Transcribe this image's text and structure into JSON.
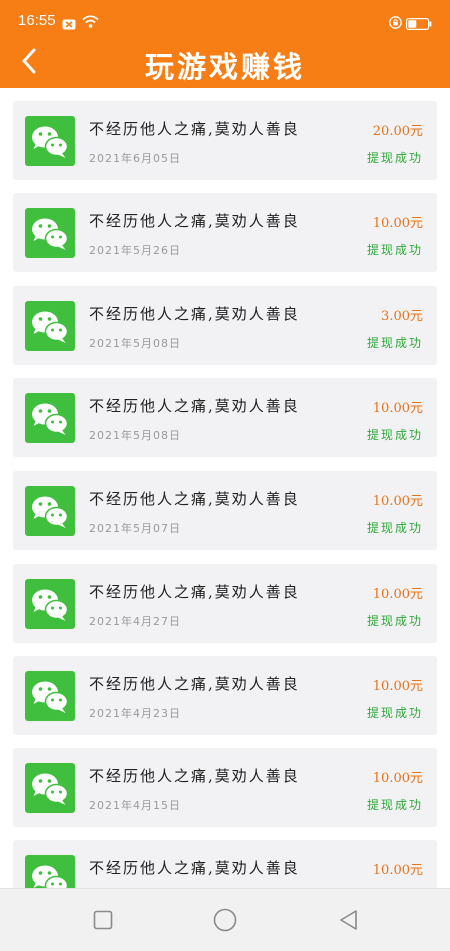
{
  "status_bar": {
    "time": "16:55"
  },
  "header": {
    "title": "玩游戏赚钱"
  },
  "items": [
    {
      "title": "不经历他人之痛,莫劝人善良",
      "date": "2021年6月05日",
      "amount": "20.00元",
      "status": "提现成功"
    },
    {
      "title": "不经历他人之痛,莫劝人善良",
      "date": "2021年5月26日",
      "amount": "10.00元",
      "status": "提现成功"
    },
    {
      "title": "不经历他人之痛,莫劝人善良",
      "date": "2021年5月08日",
      "amount": "3.00元",
      "status": "提现成功"
    },
    {
      "title": "不经历他人之痛,莫劝人善良",
      "date": "2021年5月08日",
      "amount": "10.00元",
      "status": "提现成功"
    },
    {
      "title": "不经历他人之痛,莫劝人善良",
      "date": "2021年5月07日",
      "amount": "10.00元",
      "status": "提现成功"
    },
    {
      "title": "不经历他人之痛,莫劝人善良",
      "date": "2021年4月27日",
      "amount": "10.00元",
      "status": "提现成功"
    },
    {
      "title": "不经历他人之痛,莫劝人善良",
      "date": "2021年4月23日",
      "amount": "10.00元",
      "status": "提现成功"
    },
    {
      "title": "不经历他人之痛,莫劝人善良",
      "date": "2021年4月15日",
      "amount": "10.00元",
      "status": "提现成功"
    },
    {
      "title": "不经历他人之痛,莫劝人善良",
      "date": "",
      "amount": "10.00元",
      "status": ""
    }
  ],
  "icons": {
    "back": "back-arrow-icon",
    "item": "wechat-icon",
    "nav": [
      "square-icon",
      "circle-icon",
      "triangle-icon"
    ]
  },
  "colors": {
    "header": "#f77d15",
    "amount": "#e7741a",
    "status": "#2fa83a",
    "wechat": "#40bf3e",
    "card": "#f2f2f4"
  }
}
